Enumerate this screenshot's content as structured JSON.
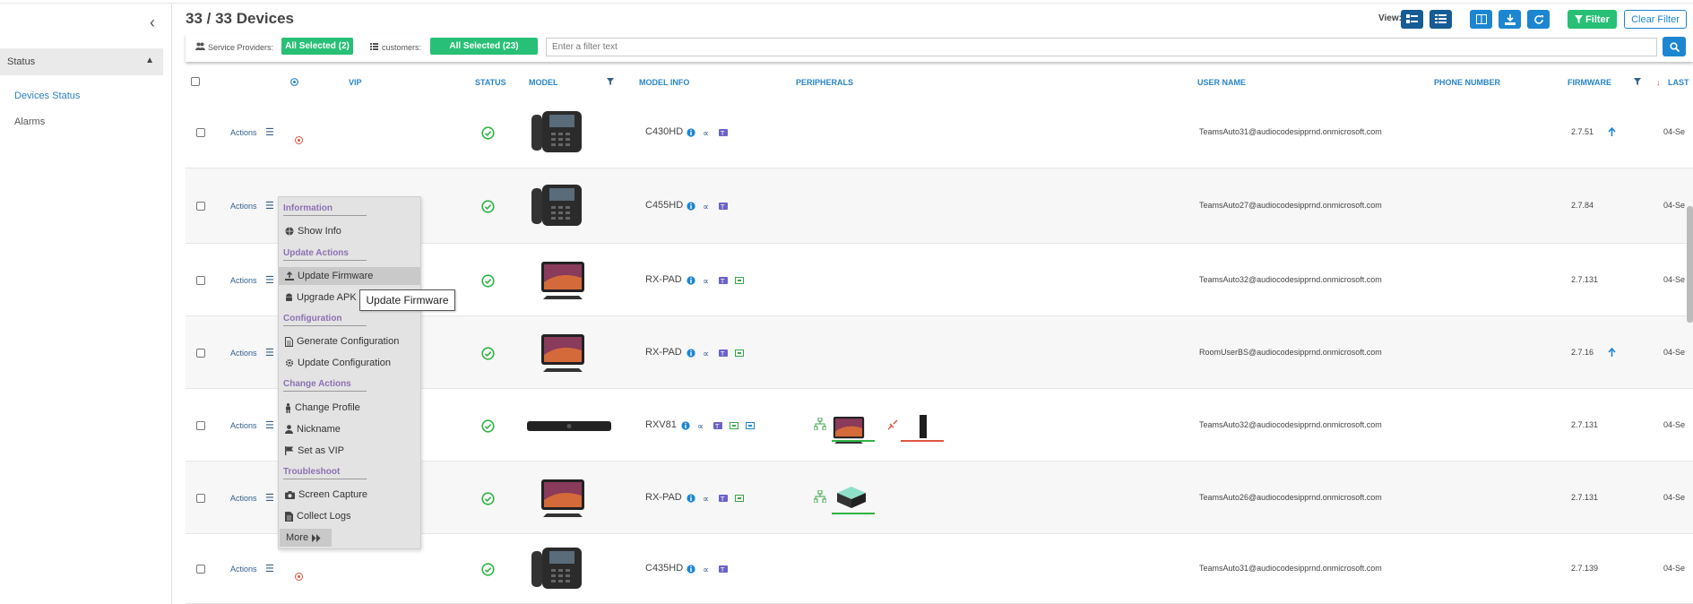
{
  "header": {
    "title": "33 / 33 Devices",
    "view_label": "View:",
    "filter_label": "Filter",
    "clear_filter_label": "Clear Filter"
  },
  "sidebar": {
    "section": "Status",
    "items": [
      {
        "label": "Devices Status",
        "active": true
      },
      {
        "label": "Alarms",
        "active": false
      }
    ]
  },
  "filterbar": {
    "service_providers_label": "Service Providers:",
    "service_providers_value": "All Selected (2)",
    "customers_label": "customers:",
    "customers_value": "All Selected (23)",
    "search_placeholder": "Enter a filter text"
  },
  "columns": {
    "vip": "VIP",
    "status": "STATUS",
    "model": "MODEL",
    "model_info": "MODEL INFO",
    "peripherals": "PERIPHERALS",
    "user_name": "USER NAME",
    "phone_number": "PHONE NUMBER",
    "firmware": "FIRMWARE",
    "last": "LAST"
  },
  "rows": [
    {
      "actions": "Actions",
      "vip": true,
      "model": "C430HD",
      "device": "phone",
      "teams_icons": 3,
      "user": "TeamsAuto31@audiocodesipprnd.onmicrosoft.com",
      "firmware": "2.7.51",
      "upgrade": true,
      "last": "04-Se"
    },
    {
      "actions": "Actions",
      "vip": false,
      "model": "C455HD",
      "device": "phone",
      "teams_icons": 3,
      "user": "TeamsAuto27@audiocodesipprnd.onmicrosoft.com",
      "firmware": "2.7.84",
      "upgrade": false,
      "last": "04-Se"
    },
    {
      "actions": "Actions",
      "vip": false,
      "model": "RX-PAD",
      "device": "pad",
      "teams_icons": 4,
      "user": "TeamsAuto32@audiocodesipprnd.onmicrosoft.com",
      "firmware": "2.7.131",
      "upgrade": false,
      "last": "04-Se"
    },
    {
      "actions": "Actions",
      "vip": false,
      "model": "RX-PAD",
      "device": "pad",
      "teams_icons": 4,
      "user": "RoomUserBS@audiocodesipprnd.onmicrosoft.com",
      "firmware": "2.7.16",
      "upgrade": true,
      "last": "04-Se"
    },
    {
      "actions": "Actions",
      "vip": false,
      "model": "RXV81",
      "device": "bar",
      "teams_icons": 5,
      "user": "TeamsAuto32@audiocodesipprnd.onmicrosoft.com",
      "firmware": "2.7.131",
      "upgrade": false,
      "last": "04-Se"
    },
    {
      "actions": "Actions",
      "vip": false,
      "model": "RX-PAD",
      "device": "pad",
      "teams_icons": 4,
      "user": "TeamsAuto26@audiocodesipprnd.onmicrosoft.com",
      "firmware": "2.7.131",
      "upgrade": false,
      "last": "04-Se"
    },
    {
      "actions": "Actions",
      "vip": true,
      "model": "C435HD",
      "device": "phone",
      "teams_icons": 3,
      "user": "TeamsAuto31@audiocodesipprnd.onmicrosoft.com",
      "firmware": "2.7.139",
      "upgrade": false,
      "last": "04-Se"
    }
  ],
  "menu": {
    "sections": [
      {
        "heading": "Information",
        "items": [
          {
            "label": "Show Info",
            "icon": "globe-icon"
          }
        ]
      },
      {
        "heading": "Update Actions",
        "items": [
          {
            "label": "Update Firmware",
            "icon": "upload-icon"
          },
          {
            "label": "Upgrade APK",
            "icon": "android-icon"
          }
        ]
      },
      {
        "heading": "Configuration",
        "items": [
          {
            "label": "Generate Configuration",
            "icon": "file-icon"
          },
          {
            "label": "Update Configuration",
            "icon": "cog-icon"
          }
        ]
      },
      {
        "heading": "Change Actions",
        "items": [
          {
            "label": "Change Profile",
            "icon": "person-icon"
          },
          {
            "label": "Nickname",
            "icon": "user-icon"
          },
          {
            "label": "Set as VIP",
            "icon": "flag-icon"
          }
        ]
      },
      {
        "heading": "Troubleshoot",
        "items": [
          {
            "label": "Screen Capture",
            "icon": "camera-icon"
          },
          {
            "label": "Collect Logs",
            "icon": "log-file-icon"
          }
        ]
      }
    ],
    "more_label": "More",
    "tooltip": "Update Firmware"
  },
  "colors": {
    "accent_blue": "#1c86d1",
    "green": "#27c076",
    "menu_heading": "#8c71b4",
    "status_ok": "#2fb344",
    "vip_red": "#e0553d"
  }
}
